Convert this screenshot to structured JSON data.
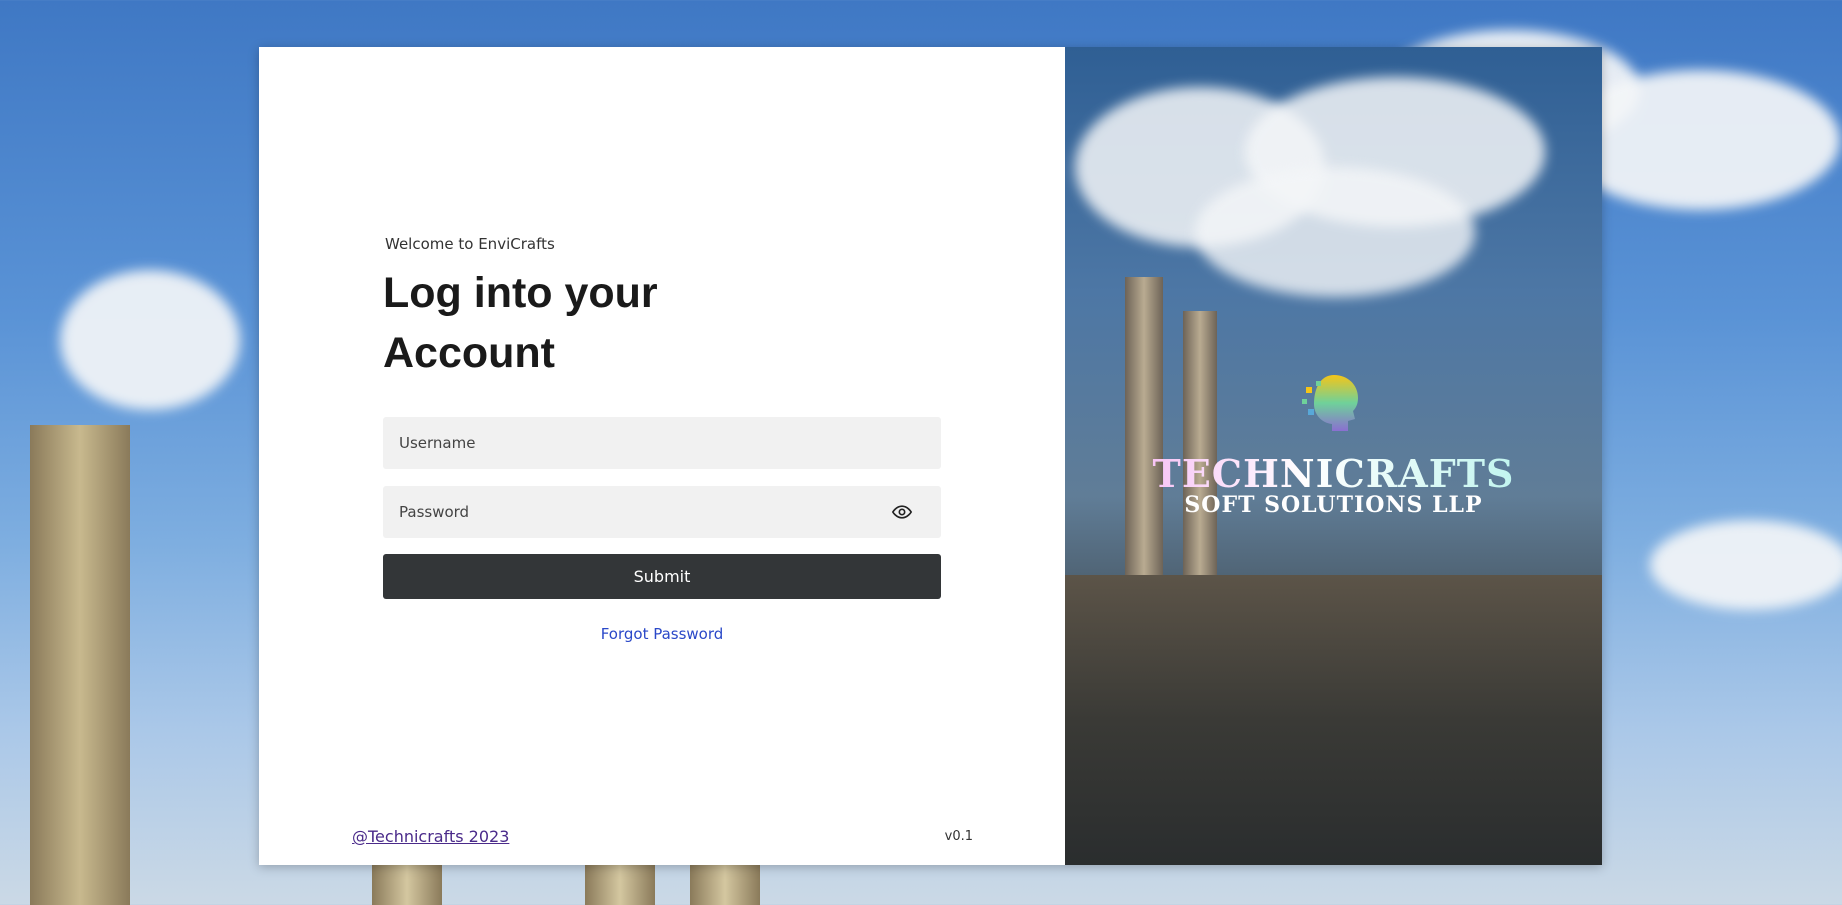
{
  "login": {
    "welcome": "Welcome to EnviCrafts",
    "title": "Log into your Account",
    "username_placeholder": "Username",
    "password_placeholder": "Password",
    "submit_label": "Submit",
    "forgot_label": "Forgot Password"
  },
  "footer": {
    "copyright": "@Technicrafts 2023",
    "version": "v0.1"
  },
  "brand": {
    "name": "TECHNICRAFTS",
    "subtitle": "SOFT SOLUTIONS LLP"
  },
  "colors": {
    "submit_bg": "#333638",
    "link": "#2a48c8",
    "field_bg": "#f1f1f1"
  }
}
